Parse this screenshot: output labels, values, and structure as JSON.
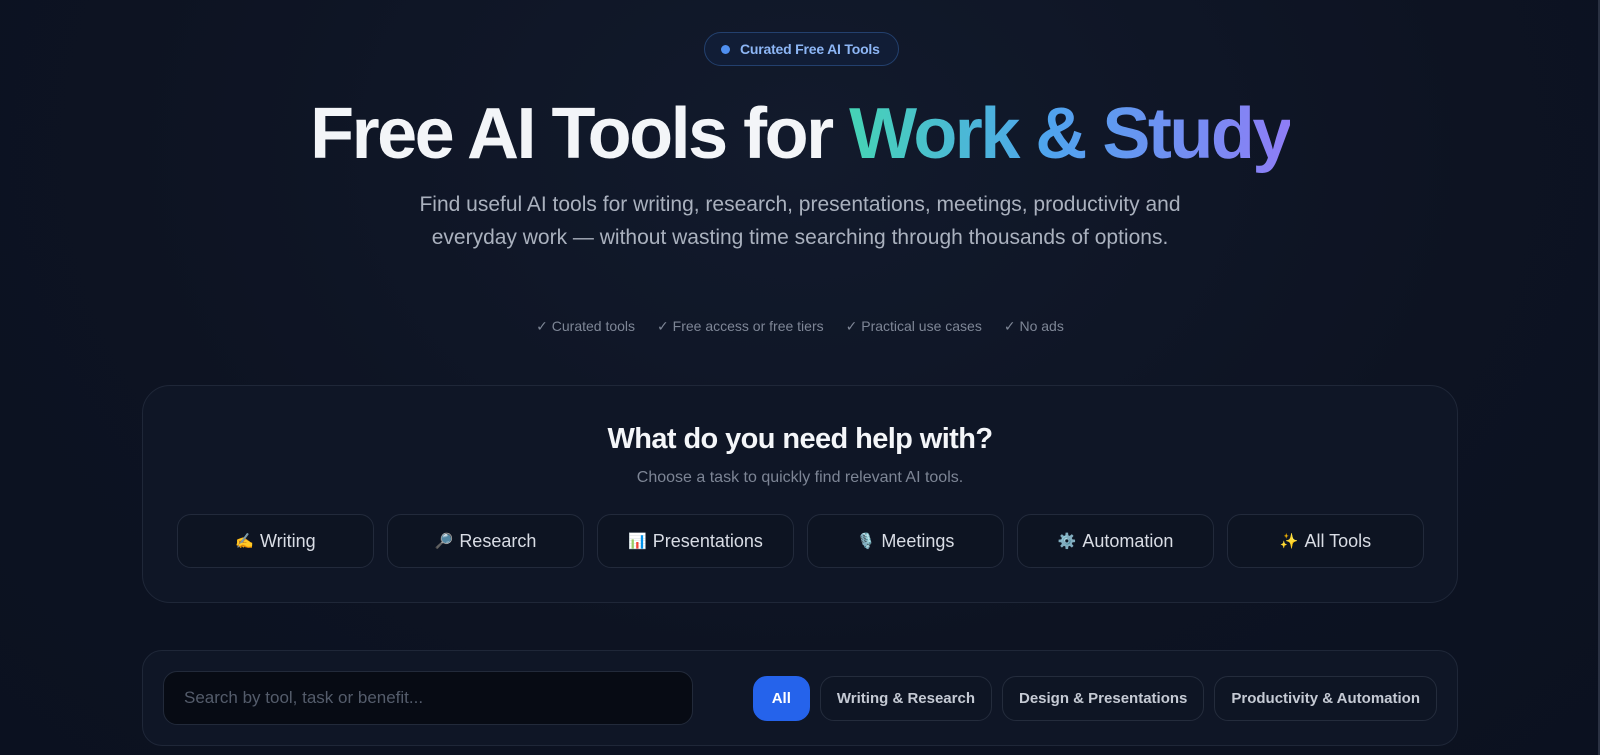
{
  "badge": {
    "text": "Curated Free AI Tools"
  },
  "hero": {
    "title_plain": "Free AI Tools for ",
    "title_accent": "Work & Study",
    "subtitle": "Find useful AI tools for writing, research, presentations, meetings, productivity and everyday work — without wasting time searching through thousands of options."
  },
  "checks": [
    "✓ Curated tools",
    "✓ Free access or free tiers",
    "✓ Practical use cases",
    "✓ No ads"
  ],
  "help": {
    "title": "What do you need help with?",
    "subtitle": "Choose a task to quickly find relevant AI tools.",
    "tasks": [
      {
        "icon": "✍️",
        "icon_name": "writing-hand-icon",
        "label": "Writing"
      },
      {
        "icon": "🔎",
        "icon_name": "magnifier-icon",
        "label": "Research"
      },
      {
        "icon": "📊",
        "icon_name": "bar-chart-icon",
        "label": "Presentations"
      },
      {
        "icon": "🎙️",
        "icon_name": "microphone-icon",
        "label": "Meetings"
      },
      {
        "icon": "⚙️",
        "icon_name": "gear-icon",
        "label": "Automation"
      },
      {
        "icon": "✨",
        "icon_name": "sparkles-icon",
        "label": "All Tools"
      }
    ]
  },
  "filter": {
    "search_placeholder": "Search by tool, task or benefit...",
    "search_value": "",
    "categories": [
      {
        "label": "All",
        "active": true
      },
      {
        "label": "Writing & Research",
        "active": false
      },
      {
        "label": "Design & Presentations",
        "active": false
      },
      {
        "label": "Productivity & Automation",
        "active": false
      }
    ]
  },
  "colors": {
    "background": "#0d1322",
    "accent_blue": "#2563eb",
    "gradient_start": "#46d4b5",
    "gradient_mid": "#4fa4ee",
    "gradient_end": "#8f7df6"
  }
}
